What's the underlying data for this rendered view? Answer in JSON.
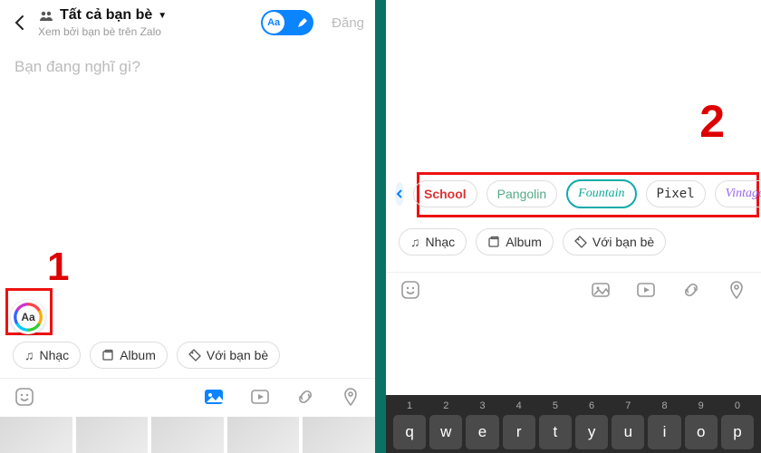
{
  "left": {
    "audience_label": "Tất cả bạn bè",
    "audience_sub": "Xem bởi bạn bè trên Zalo",
    "toggle_aa": "Aa",
    "post_label": "Đăng",
    "composer_placeholder": "Bạn đang nghĩ gì?",
    "aa_badge": "Aa",
    "chips": {
      "music": "Nhạc",
      "album": "Album",
      "withfriends": "Với bạn bè"
    },
    "callout": "1"
  },
  "right": {
    "callout": "2",
    "fonts": {
      "school": "School",
      "pangolin": "Pangolin",
      "fountain": "Fountain",
      "pixel": "Pixel",
      "vintage": "Vintage"
    },
    "chips": {
      "music": "Nhạc",
      "album": "Album",
      "withfriends": "Với bạn bè"
    },
    "keyboard": {
      "numbers": [
        "1",
        "2",
        "3",
        "4",
        "5",
        "6",
        "7",
        "8",
        "9",
        "0"
      ],
      "row1": [
        "q",
        "w",
        "e",
        "r",
        "t",
        "y",
        "u",
        "i",
        "o",
        "p"
      ]
    }
  }
}
